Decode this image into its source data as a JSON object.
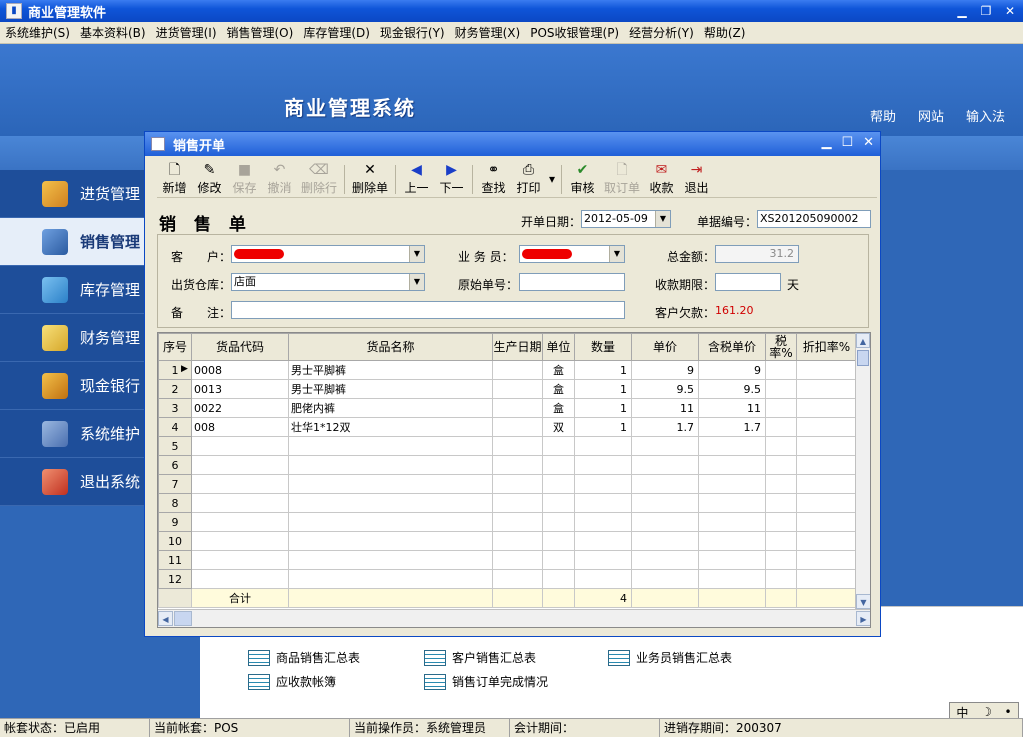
{
  "app": {
    "title": "商业管理软件"
  },
  "menu": [
    "系统维护(S)",
    "基本资料(B)",
    "进货管理(I)",
    "销售管理(O)",
    "库存管理(D)",
    "现金银行(Y)",
    "财务管理(X)",
    "POS收银管理(P)",
    "经营分析(Y)",
    "帮助(Z)"
  ],
  "header": {
    "system_title": "商业管理系统",
    "links": [
      "帮助",
      "网站",
      "输入法"
    ]
  },
  "sidenav": [
    "进货管理",
    "销售管理",
    "库存管理",
    "财务管理",
    "现金银行",
    "系统维护",
    "退出系统"
  ],
  "reports": [
    "商品销售汇总表",
    "客户销售汇总表",
    "业务员销售汇总表",
    "应收款帐簿",
    "销售订单完成情况"
  ],
  "ime": {
    "label": "中"
  },
  "status": {
    "account_status": "帐套状态：已启用",
    "current_account": "当前帐套：POS",
    "operator": "当前操作员：系统管理员",
    "period": "会计期间：",
    "inventory_period": "进销存期间：200307"
  },
  "dialog": {
    "title": "销售开单",
    "toolbar": [
      {
        "label": "新增",
        "icon": "new-doc-icon"
      },
      {
        "label": "修改",
        "icon": "edit-icon"
      },
      {
        "label": "保存",
        "icon": "save-icon"
      },
      {
        "label": "撤消",
        "icon": "undo-icon"
      },
      {
        "label": "删除行",
        "icon": "delete-row-icon"
      },
      {
        "label": "删除单",
        "icon": "delete-icon"
      },
      {
        "label": "上一",
        "icon": "prev-icon"
      },
      {
        "label": "下一",
        "icon": "next-icon"
      },
      {
        "label": "查找",
        "icon": "binoculars-icon"
      },
      {
        "label": "打印",
        "icon": "printer-icon"
      },
      {
        "label": "审核",
        "icon": "approve-icon"
      },
      {
        "label": "取订单",
        "icon": "fetch-order-icon"
      },
      {
        "label": "收款",
        "icon": "receive-payment-icon"
      },
      {
        "label": "退出",
        "icon": "exit-icon"
      }
    ],
    "form": {
      "heading": "销 售 单",
      "open_date_label": "开单日期：",
      "open_date": "2012-05-09",
      "doc_no_label": "单据编号：",
      "doc_no": "XS201205090002",
      "customer_label": "客　　户：",
      "salesman_label": "业 务 员：",
      "total_label": "总金额：",
      "total": "31.2",
      "warehouse_label": "出货仓库：",
      "warehouse": "店面",
      "orig_no_label": "原始单号：",
      "term_label": "收款期限：",
      "term_unit": "天",
      "note_label": "备　　注：",
      "debt_label": "客户欠款：",
      "debt": "161.20"
    },
    "grid": {
      "headers": [
        "序号",
        "货品代码",
        "货品名称",
        "生产日期",
        "单位",
        "数量",
        "单价",
        "含税单价",
        "税率%",
        "折扣率%"
      ],
      "rows": [
        [
          "1",
          "0008",
          "男士平脚裤",
          "",
          "盒",
          "1",
          "9",
          "9",
          "",
          ""
        ],
        [
          "2",
          "0013",
          "男士平脚裤",
          "",
          "盒",
          "1",
          "9.5",
          "9.5",
          "",
          ""
        ],
        [
          "3",
          "0022",
          "肥佬内裤",
          "",
          "盒",
          "1",
          "11",
          "11",
          "",
          ""
        ],
        [
          "4",
          "008",
          "壮华1*12双",
          "",
          "双",
          "1",
          "1.7",
          "1.7",
          "",
          ""
        ],
        [
          "5",
          "",
          "",
          "",
          "",
          "",
          "",
          "",
          "",
          ""
        ],
        [
          "6",
          "",
          "",
          "",
          "",
          "",
          "",
          "",
          "",
          ""
        ],
        [
          "7",
          "",
          "",
          "",
          "",
          "",
          "",
          "",
          "",
          ""
        ],
        [
          "8",
          "",
          "",
          "",
          "",
          "",
          "",
          "",
          "",
          ""
        ],
        [
          "9",
          "",
          "",
          "",
          "",
          "",
          "",
          "",
          "",
          ""
        ],
        [
          "10",
          "",
          "",
          "",
          "",
          "",
          "",
          "",
          "",
          ""
        ],
        [
          "11",
          "",
          "",
          "",
          "",
          "",
          "",
          "",
          "",
          ""
        ],
        [
          "12",
          "",
          "",
          "",
          "",
          "",
          "",
          "",
          "",
          ""
        ]
      ],
      "sum_label": "合计",
      "sum_qty": "4"
    }
  }
}
